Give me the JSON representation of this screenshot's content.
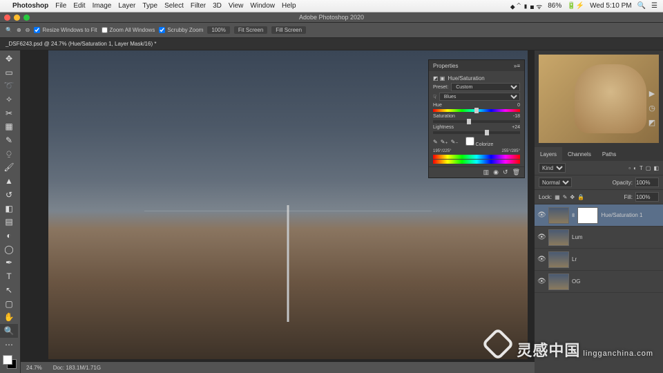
{
  "mac_menu": {
    "app": "Photoshop",
    "items": [
      "File",
      "Edit",
      "Image",
      "Layer",
      "Type",
      "Select",
      "Filter",
      "3D",
      "View",
      "Window",
      "Help"
    ],
    "battery": "86%",
    "time": "Wed 5:10 PM"
  },
  "app_title": "Adobe Photoshop 2020",
  "options_bar": {
    "resize_windows": "Resize Windows to Fit",
    "zoom_all": "Zoom All Windows",
    "scrubby": "Scrubby Zoom",
    "btn_100": "100%",
    "btn_fit": "Fit Screen",
    "btn_fill": "Fill Screen"
  },
  "doc_tab": "_DSF6243.psd @ 24.7% (Hue/Saturation 1, Layer Mask/16) *",
  "footer": {
    "zoom": "24.7%",
    "doc": "Doc: 183.1M/1.71G"
  },
  "properties": {
    "title": "Properties",
    "adj_name": "Hue/Saturation",
    "preset_label": "Preset:",
    "preset_value": "Custom",
    "channel": "Blues",
    "hue_label": "Hue",
    "hue_value": "0",
    "sat_label": "Saturation",
    "sat_value": "-18",
    "light_label": "Lightness",
    "light_value": "+24",
    "colorize": "Colorize",
    "range_left": "195°/225°",
    "range_right": "255°/285°"
  },
  "layers": {
    "tabs": [
      "Layers",
      "Channels",
      "Paths"
    ],
    "kind": "Kind",
    "blend": "Normal",
    "opacity_label": "Opacity:",
    "opacity": "100%",
    "lock_label": "Lock:",
    "fill_label": "Fill:",
    "fill": "100%",
    "items": [
      {
        "name": "Hue/Saturation 1",
        "selected": true,
        "mask": true
      },
      {
        "name": "Lum",
        "selected": false,
        "mask": false
      },
      {
        "name": "Lr",
        "selected": false,
        "mask": false
      },
      {
        "name": "OG",
        "selected": false,
        "mask": false
      }
    ]
  },
  "watermark": {
    "cn": "灵感中国",
    "domain": "lingganchina.com"
  }
}
